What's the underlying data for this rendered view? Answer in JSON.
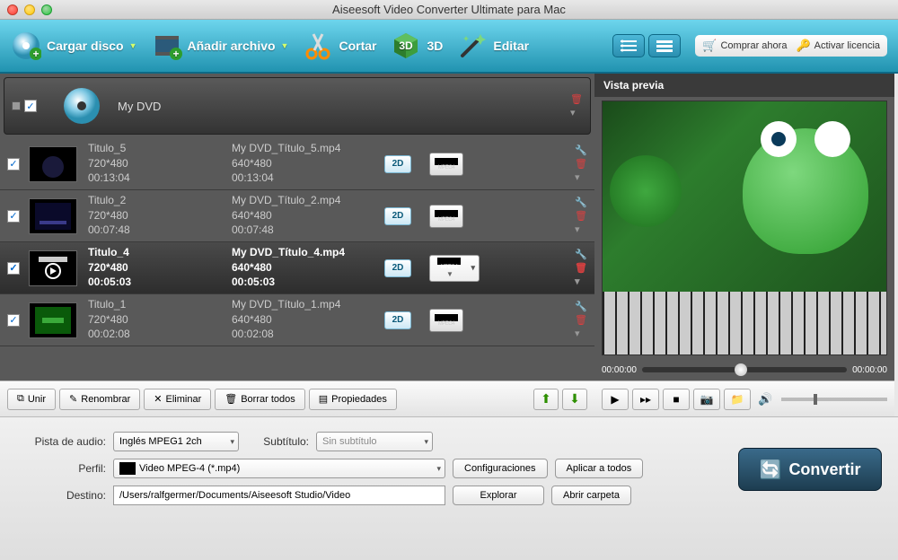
{
  "window": {
    "title": "Aiseesoft Video Converter Ultimate para Mac"
  },
  "toolbar": {
    "load_disc": "Cargar disco",
    "add_file": "Añadir archivo",
    "cut": "Cortar",
    "three_d": "3D",
    "edit": "Editar",
    "buy_now": "Comprar ahora",
    "activate": "Activar licencia"
  },
  "dvd": {
    "label": "My DVD"
  },
  "items": [
    {
      "title": "Titulo_5",
      "src_res": "720*480",
      "src_dur": "00:13:04",
      "out_name": "My DVD_Título_5.mp4",
      "out_res": "640*480",
      "out_dur": "00:13:04",
      "fmt": "MPEG4"
    },
    {
      "title": "Titulo_2",
      "src_res": "720*480",
      "src_dur": "00:07:48",
      "out_name": "My DVD_Título_2.mp4",
      "out_res": "640*480",
      "out_dur": "00:07:48",
      "fmt": "MPEG4"
    },
    {
      "title": "Titulo_4",
      "src_res": "720*480",
      "src_dur": "00:05:03",
      "out_name": "My DVD_Título_4.mp4",
      "out_res": "640*480",
      "out_dur": "00:05:03",
      "fmt": "MPEG4"
    },
    {
      "title": "Titulo_1",
      "src_res": "720*480",
      "src_dur": "00:02:08",
      "out_name": "My DVD_Título_1.mp4",
      "out_res": "640*480",
      "out_dur": "00:02:08",
      "fmt": "MPEG4"
    }
  ],
  "footer": {
    "join": "Unir",
    "rename": "Renombrar",
    "delete": "Eliminar",
    "clear_all": "Borrar todos",
    "properties": "Propiedades"
  },
  "preview": {
    "title": "Vista previa",
    "time_start": "00:00:00",
    "time_end": "00:00:00"
  },
  "settings": {
    "audio_track_label": "Pista de audio:",
    "audio_track_value": "Inglés MPEG1 2ch",
    "subtitle_label": "Subtítulo:",
    "subtitle_value": "Sin subtítulo",
    "profile_label": "Perfil:",
    "profile_value": "Video MPEG-4 (*.mp4)",
    "dest_label": "Destino:",
    "dest_value": "/Users/ralfgermer/Documents/Aiseesoft Studio/Video",
    "config_btn": "Configuraciones",
    "apply_all_btn": "Aplicar a todos",
    "browse_btn": "Explorar",
    "open_folder_btn": "Abrir carpeta"
  },
  "convert": {
    "label": "Convertir"
  },
  "badge": {
    "two_d": "2D"
  }
}
